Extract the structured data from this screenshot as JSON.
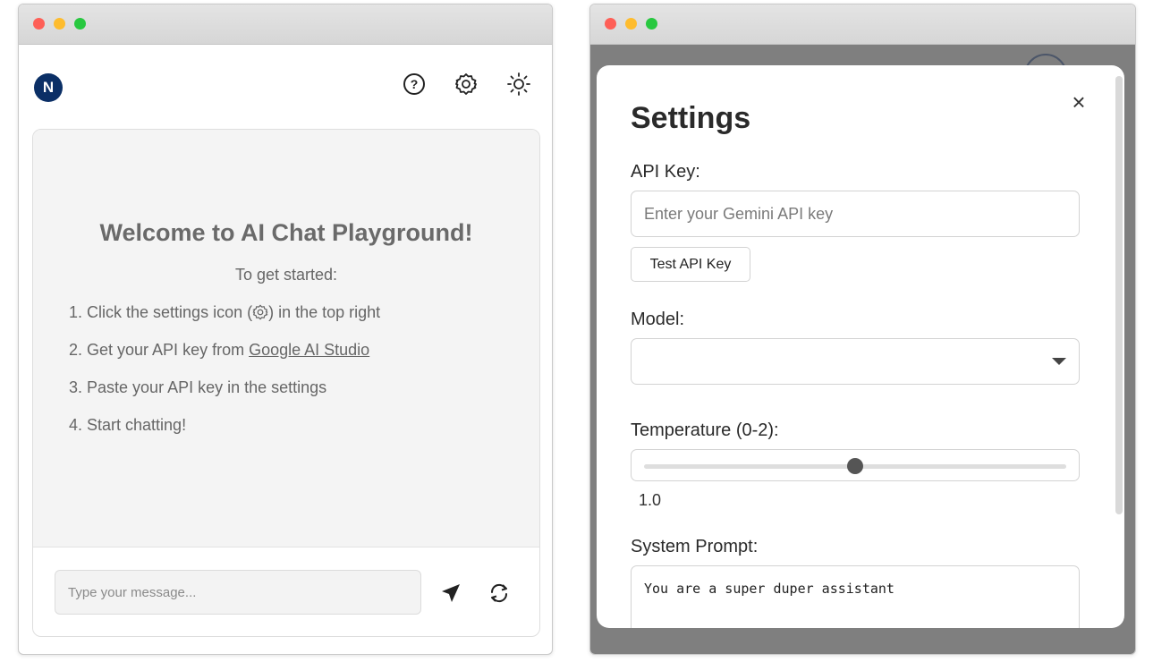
{
  "left_app": {
    "logo_letter": "N",
    "welcome": {
      "title": "Welcome to AI Chat Playground!",
      "subtitle": "To get started:",
      "steps": [
        {
          "before": "1. Click the settings icon (",
          "after": ") in the top right"
        },
        {
          "before": "2. Get your API key from ",
          "link": "Google AI Studio"
        },
        {
          "text": "3. Paste your API key in the settings"
        },
        {
          "text": "4. Start chatting!"
        }
      ]
    },
    "message_placeholder": "Type your message..."
  },
  "settings_modal": {
    "title": "Settings",
    "close_glyph": "×",
    "api_key_label": "API Key:",
    "api_key_placeholder": "Enter your Gemini API key",
    "test_button": "Test API Key",
    "model_label": "Model:",
    "model_value": "",
    "temperature_label": "Temperature (0-2):",
    "temperature": {
      "min": 0,
      "max": 2,
      "value": 1.0,
      "display": "1.0"
    },
    "system_prompt_label": "System Prompt:",
    "system_prompt_value": "You are a super duper assistant"
  },
  "colors": {
    "logo_bg": "#0b2f66",
    "traffic_red": "#fe5f57",
    "traffic_yellow": "#febc2e",
    "traffic_green": "#28c840",
    "overlay": "#7f7f7f"
  },
  "icons": [
    "help-icon",
    "gear-icon",
    "sun-icon",
    "send-icon",
    "refresh-icon",
    "close-icon",
    "chevron-down-icon"
  ]
}
